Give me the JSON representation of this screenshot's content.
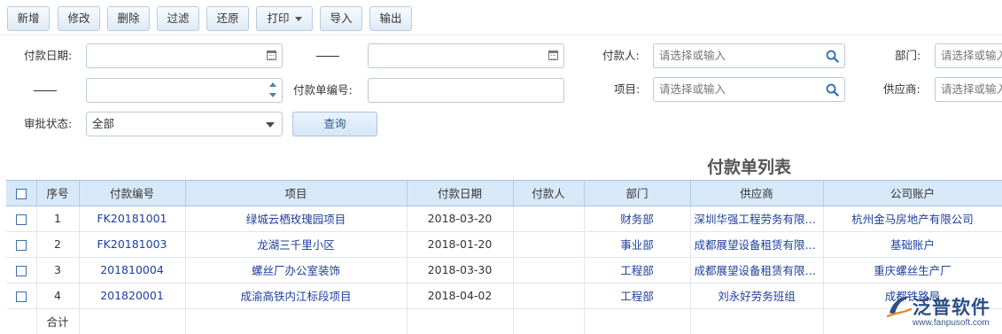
{
  "toolbar": {
    "buttons": [
      "新增",
      "修改",
      "删除",
      "过滤",
      "还原",
      "打印",
      "导入",
      "输出"
    ]
  },
  "filters": {
    "pay_date_label": "付款日期:",
    "range_sep": "——",
    "payer_label": "付款人:",
    "payer_placeholder": "请选择或输入",
    "dept_label": "部门:",
    "dept_placeholder": "请选择或输入",
    "pay_no_label": "付款单编号:",
    "project_label": "项目:",
    "project_placeholder": "请选择或输入",
    "supplier_label": "供应商:",
    "supplier_placeholder": "请选择或输入",
    "approval_label": "审批状态:",
    "approval_value": "全部",
    "query_label": "查询"
  },
  "list_title": "付款单列表",
  "table": {
    "headers": [
      "",
      "序号",
      "付款编号",
      "项目",
      "付款日期",
      "付款人",
      "部门",
      "供应商",
      "公司账户"
    ],
    "rows": [
      {
        "seq": "1",
        "no": "FK20181001",
        "project": "绿城云栖玫瑰园项目",
        "date": "2018-03-20",
        "payer": "",
        "dept": "财务部",
        "supplier": "深圳华强工程劳务有限公司",
        "account": "杭州金马房地产有限公司"
      },
      {
        "seq": "2",
        "no": "FK20181003",
        "project": "龙湖三千里小区",
        "date": "2018-01-20",
        "payer": "",
        "dept": "事业部",
        "supplier": "成都展望设备租赁有限公司",
        "account": "基础账户"
      },
      {
        "seq": "3",
        "no": "201810004",
        "project": "螺丝厂办公室装饰",
        "date": "2018-03-30",
        "payer": "",
        "dept": "工程部",
        "supplier": "成都展望设备租赁有限公司",
        "account": "重庆螺丝生产厂"
      },
      {
        "seq": "4",
        "no": "201820001",
        "project": "成渝高铁内江标段项目",
        "date": "2018-04-02",
        "payer": "",
        "dept": "工程部",
        "supplier": "刘永好劳务班组",
        "account": "成都铁路局"
      }
    ],
    "total_label": "合计"
  },
  "logo": {
    "brand": "泛普软件",
    "site": "www.fanpusoft.com"
  },
  "colors": {
    "header_bg": "#d7e8f8",
    "link": "#1e3f9c",
    "accent": "#2f6fb0"
  }
}
